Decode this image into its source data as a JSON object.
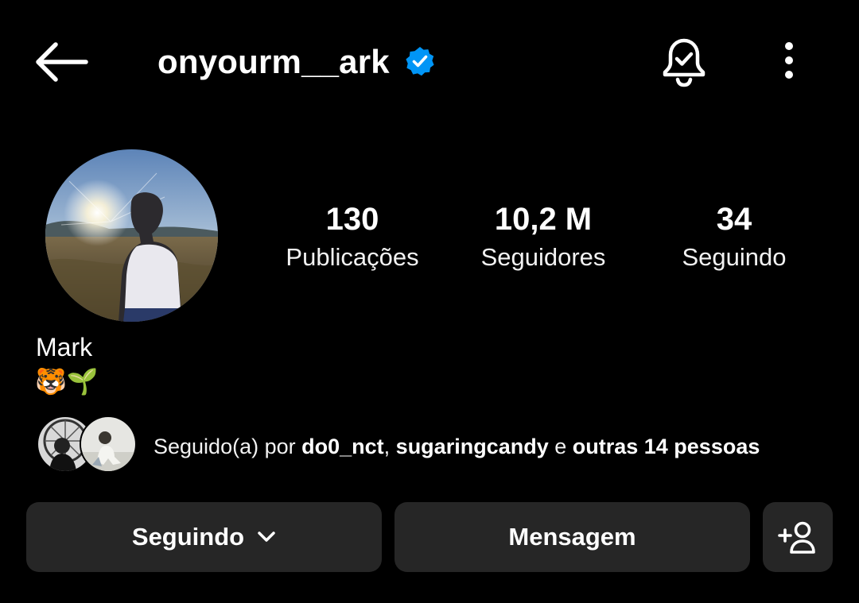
{
  "header": {
    "username": "onyourm__ark",
    "icons": {
      "back": "arrow-left-icon",
      "verified": "verified-badge-icon",
      "notifications": "bell-check-icon",
      "more": "more-vertical-icon"
    }
  },
  "profile": {
    "display_name": "Mark",
    "bio": "🐯🌱"
  },
  "stats": [
    {
      "value": "130",
      "label": "Publicações"
    },
    {
      "value": "10,2 M",
      "label": "Seguidores"
    },
    {
      "value": "34",
      "label": "Seguindo"
    }
  ],
  "mutual": {
    "prefix": "Seguido(a) por ",
    "user1": "do0_nct",
    "separator": ", ",
    "user2": "sugaringcandy",
    "conjunction": " e ",
    "others": "outras 14 pessoas"
  },
  "actions": {
    "following_label": "Seguindo",
    "message_label": "Mensagem",
    "icons": {
      "dropdown": "chevron-down-icon",
      "add_user": "person-add-icon"
    }
  },
  "colors": {
    "background": "#000000",
    "button_bg": "#262626",
    "verified_blue": "#0095F6",
    "text": "#FFFFFF"
  }
}
